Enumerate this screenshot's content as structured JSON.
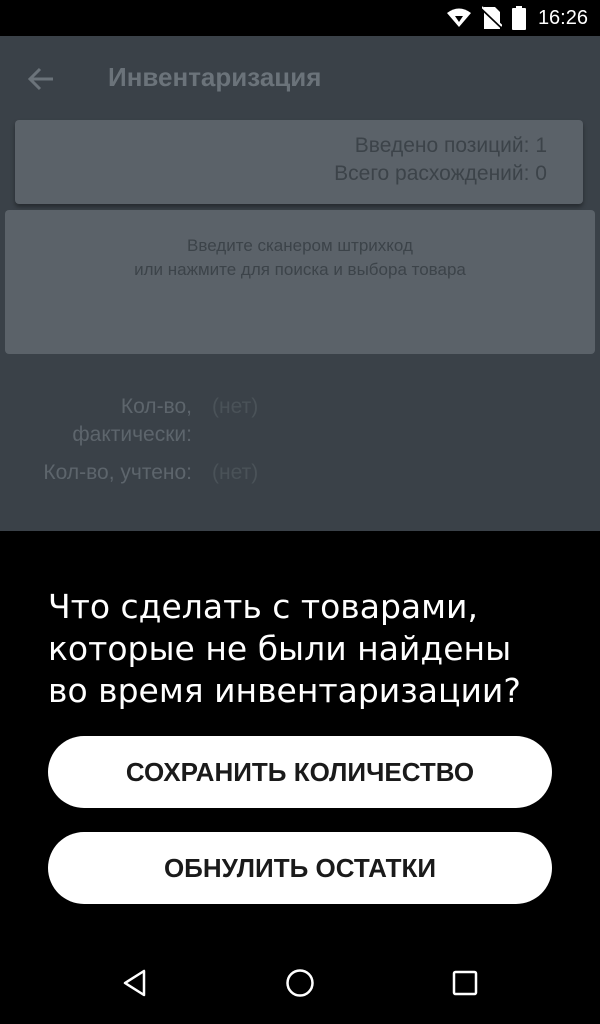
{
  "status_bar": {
    "time": "16:26",
    "icons": [
      "wifi-icon",
      "no-sim-icon",
      "battery-icon"
    ]
  },
  "toolbar": {
    "back_icon": "arrow-left-icon",
    "title": "Инвентаризация"
  },
  "summary": {
    "entered_positions": "Введено позиций: 1",
    "total_discrepancies": "Всего расхождений: 0"
  },
  "scan_box": {
    "line1": "Введите сканером штрихкод",
    "line2": "или нажмите для поиска и выбора товара"
  },
  "fields": {
    "actual_qty_label_line1": "Кол-во,",
    "actual_qty_label_line2": "фактически:",
    "actual_qty_value": "(нет)",
    "recorded_qty_label": "Кол-во, учтено:",
    "recorded_qty_value": "(нет)"
  },
  "dialog": {
    "title_line1": "Что сделать с товарами,",
    "title_line2": "которые не были найдены",
    "title_line3": "во время инвентаризации?",
    "save_quantity_label": "СОХРАНИТЬ КОЛИЧЕСТВО",
    "reset_stock_label": "ОБНУЛИТЬ ОСТАТКИ"
  },
  "nav_bar": {
    "icons": [
      "back-triangle-icon",
      "home-circle-icon",
      "recents-square-icon"
    ]
  },
  "colors": {
    "dimmed_background": "#3a4148",
    "card": "#5b6269",
    "dialog_background": "#000000",
    "button": "#ffffff"
  }
}
